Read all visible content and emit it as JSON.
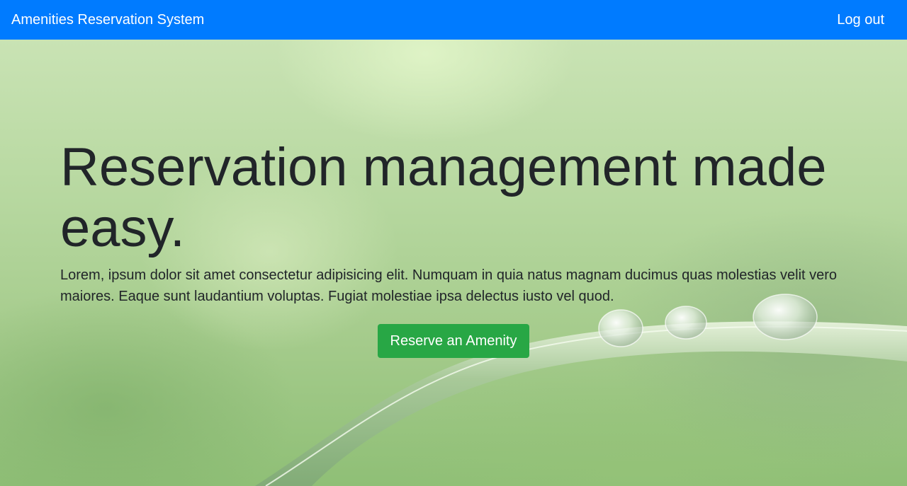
{
  "navbar": {
    "brand": "Amenities Reservation System",
    "logout_label": "Log out",
    "background": "#007bff"
  },
  "hero": {
    "headline": "Reservation management made easy.",
    "lead": "Lorem, ipsum dolor sit amet consectetur adipisicing elit. Numquam in quia natus magnam ducimus quas molestias velit vero maiores. Eaque sunt laudantium voluptas. Fugiat molestiae ipsa delectus iusto vel quod.",
    "cta_label": "Reserve an Amenity",
    "cta_color": "#28a745",
    "background_image": "grass blade with water droplets"
  }
}
